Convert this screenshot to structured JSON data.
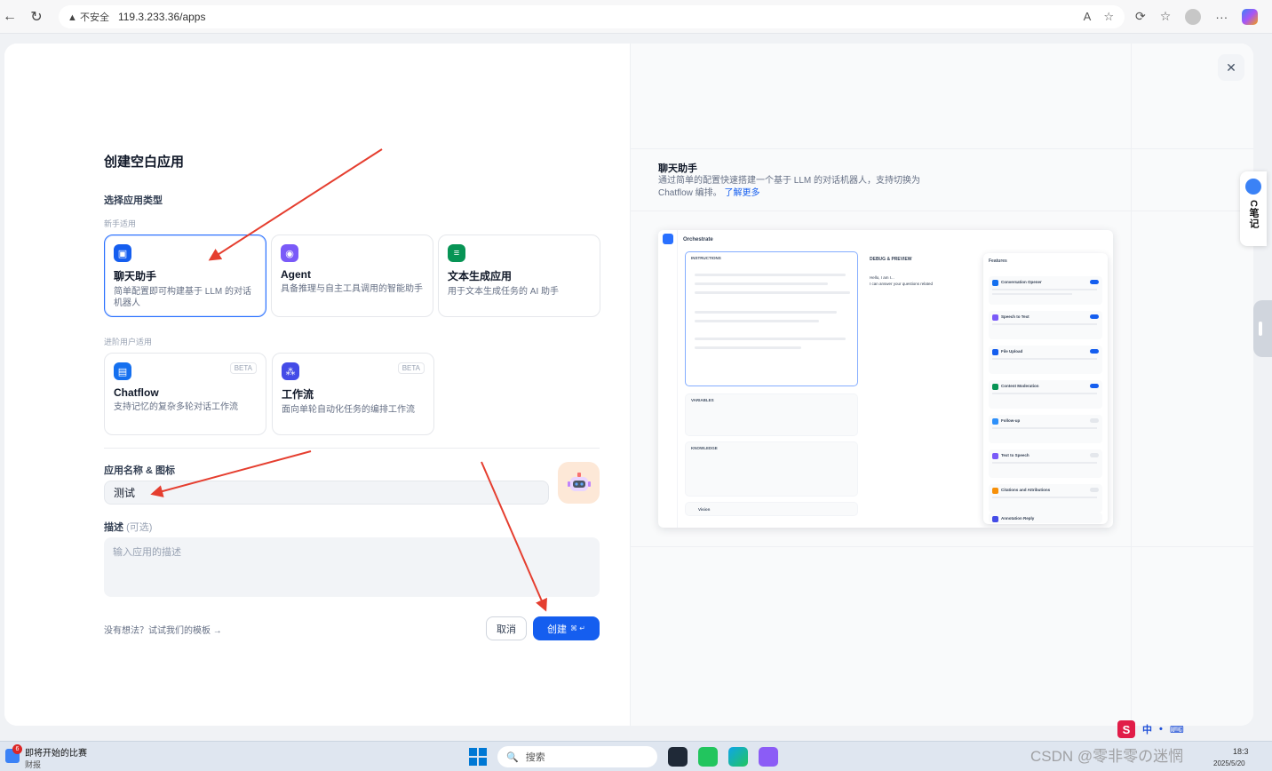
{
  "browser": {
    "security_label": "不安全",
    "url": "119.3.233.36/apps"
  },
  "modal": {
    "title": "创建空白应用",
    "app_type_label": "选择应用类型",
    "group_beginner": "新手适用",
    "group_advanced": "进阶用户适用",
    "cards": [
      {
        "title": "聊天助手",
        "desc": "简单配置即可构建基于 LLM 的对话机器人",
        "icon": "chat-bot-icon",
        "color": "#155eef",
        "selected": true
      },
      {
        "title": "Agent",
        "desc": "具备推理与自主工具调用的智能助手",
        "icon": "agent-icon",
        "color": "#7a5af8",
        "selected": false
      },
      {
        "title": "文本生成应用",
        "desc": "用于文本生成任务的 AI 助手",
        "icon": "text-generator-icon",
        "color": "#079455",
        "selected": false
      },
      {
        "title": "Chatflow",
        "desc": "支持记忆的复杂多轮对话工作流",
        "icon": "chatflow-icon",
        "color": "#1570ef",
        "beta": "BETA",
        "selected": false
      },
      {
        "title": "工作流",
        "desc": "面向单轮自动化任务的编排工作流",
        "icon": "workflow-icon",
        "color": "#444ce7",
        "beta": "BETA",
        "selected": false
      }
    ],
    "name_label": "应用名称 & 图标",
    "name_value": "测试",
    "desc_label": "描述",
    "desc_optional": "(可选)",
    "desc_placeholder": "输入应用的描述",
    "template_link": "没有想法？试试我们的模板 →",
    "cancel": "取消",
    "create": "创建",
    "create_shortcut": "⌘ ↵"
  },
  "preview": {
    "title": "聊天助手",
    "desc": "通过简单的配置快速搭建一个基于 LLM 的对话机器人，支持切换为 Chatflow 编排。",
    "learn_more": "了解更多",
    "mock": {
      "header": "Orchestrate",
      "instructions": "INSTRUCTIONS",
      "variables": "VARIABLES",
      "knowledge": "KNOWLEDGE",
      "vision": "Vision",
      "debug": "DEBUG & PREVIEW",
      "greeting": "Hello, I am I...",
      "greeting2": "I can answer your questions related",
      "features_title": "Features",
      "features": [
        "Conversation Opener",
        "Speech to Text",
        "File Upload",
        "Content Moderation",
        "Follow-up",
        "Text to Speech",
        "Citations and Attributions",
        "Annotation Reply"
      ],
      "feature_on": [
        true,
        true,
        true,
        true,
        false,
        false,
        false,
        false
      ]
    }
  },
  "side_widget": {
    "label": "C笔记"
  },
  "taskbar": {
    "news_badge": "6",
    "news_title": "即将开始的比赛",
    "news_sub": "财报",
    "search": "搜索",
    "date": "2025/5/20",
    "time": "18:3",
    "watermark": "CSDN @零非零の迷惘"
  },
  "ime": {
    "label": "中"
  }
}
